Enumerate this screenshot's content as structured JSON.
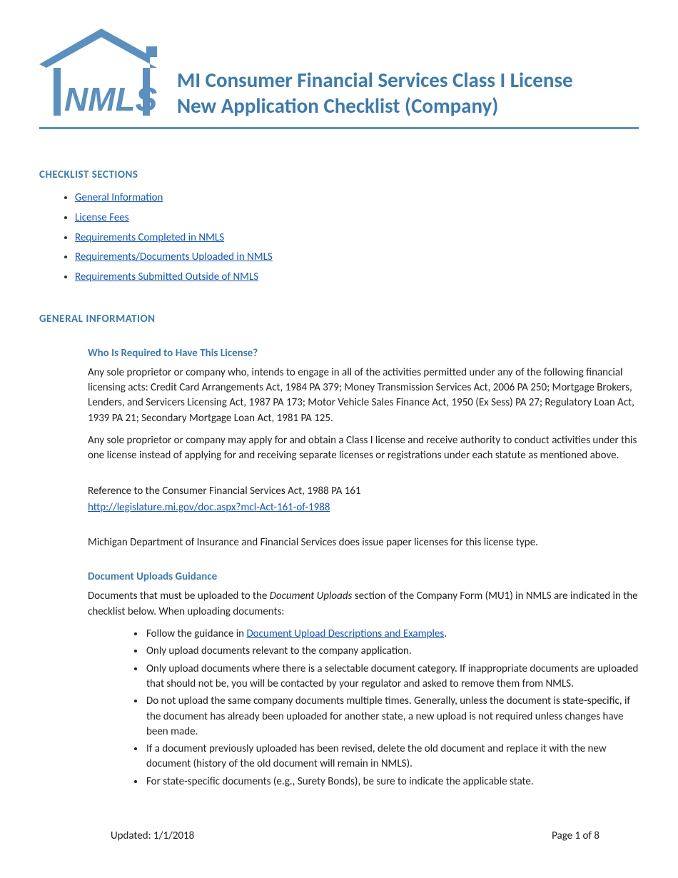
{
  "header": {
    "title_line1": "MI Consumer Financial Services Class I License",
    "title_line2": "New Application Checklist (Company)"
  },
  "sections": {
    "checklist_heading": "CHECKLIST SECTIONS",
    "checklist_links": [
      "General Information",
      "License Fees",
      "Requirements Completed in NMLS",
      "Requirements/Documents Uploaded in NMLS",
      "Requirements Submitted Outside of NMLS"
    ],
    "general_info_heading": "GENERAL INFORMATION",
    "who_required_heading": "Who Is Required to Have This License?",
    "who_required_p1": "Any sole proprietor or company who, intends to engage in all of the activities permitted under any of the following financial licensing acts: Credit Card Arrangements Act, 1984 PA 379; Money Transmission Services Act, 2006 PA 250; Mortgage Brokers, Lenders, and Servicers Licensing Act, 1987 PA 173; Motor Vehicle Sales Finance Act, 1950 (Ex Sess) PA 27; Regulatory Loan Act, 1939 PA 21; Secondary Mortgage Loan Act, 1981 PA 125.",
    "who_required_p2": "Any sole proprietor or company may apply for and obtain a Class I license and receive authority to conduct activities under this one license instead of applying for and receiving separate licenses or registrations under each statute as mentioned above.",
    "reference_label": "Reference to the Consumer Financial Services Act, 1988 PA 161",
    "reference_url": "http://legislature.mi.gov/doc.aspx?mcl-Act-161-of-1988",
    "paper_licenses": "Michigan Department of Insurance and Financial Services does issue paper licenses for this license type.",
    "doc_uploads_heading": "Document Uploads Guidance",
    "doc_uploads_intro_pre": "Documents that must be uploaded to the ",
    "doc_uploads_intro_italic": "Document Uploads",
    "doc_uploads_intro_post": " section of the Company Form (MU1) in NMLS are indicated in the checklist below. When uploading documents:",
    "guidance_items": {
      "g1_pre": "Follow the guidance in ",
      "g1_link": "Document Upload Descriptions and Examples",
      "g1_post": ".",
      "g2": "Only upload documents relevant to the company application.",
      "g3": "Only upload documents where there is a selectable document category. If inappropriate documents are uploaded that should not be, you will be contacted by your regulator and asked to remove them from NMLS.",
      "g4": "Do not upload the same company documents multiple times. Generally, unless the document is state-specific, if the document has already been uploaded for another state, a new upload is not required unless changes have been made.",
      "g5": "If a document previously uploaded has been revised, delete the old document and replace it with the new document (history of the old document will remain in NMLS).",
      "g6": "For state-specific documents (e.g., Surety Bonds), be sure to indicate the applicable state."
    }
  },
  "footer": {
    "updated": "Updated:  1/1/2018",
    "page": "Page 1 of 8"
  }
}
